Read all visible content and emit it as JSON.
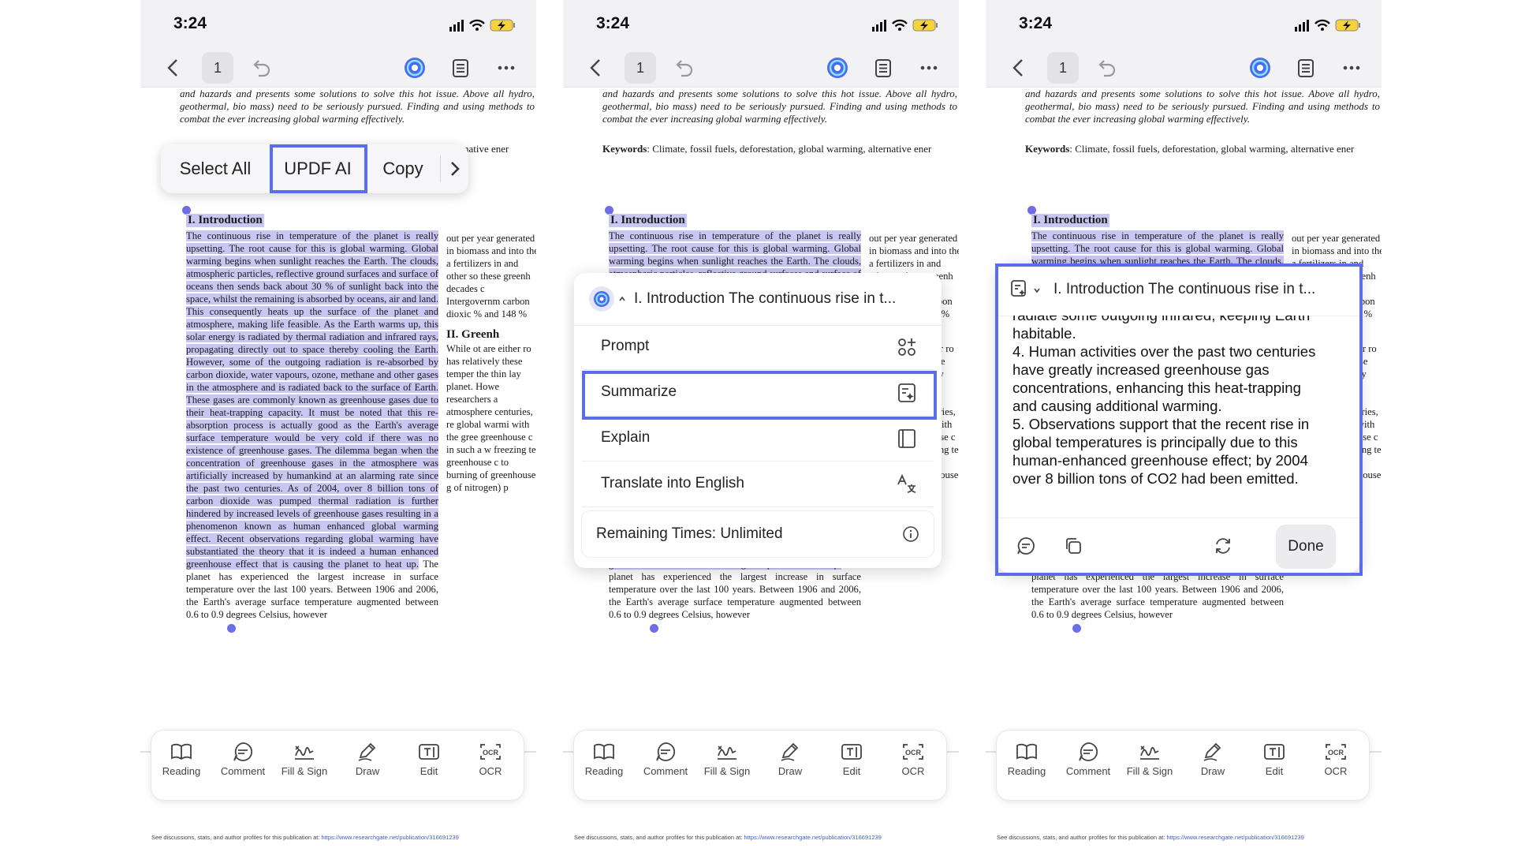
{
  "status": {
    "time": "3:24"
  },
  "toolbar": {
    "page": "1"
  },
  "doc": {
    "abstract": "and hazards and presents some solutions to solve this hot issue. Above all hydro, geothermal, bio mass) need to be seriously pursued. Finding and using methods to combat the ever increasing global warming effectively.",
    "keywords_label": "Keywords",
    "keywords_text": ": Climate, fossil fuels, deforestation, global warming, alternative ener",
    "intro_heading": "I. Introduction",
    "intro_body": "The continuous rise in temperature of the planet is really upsetting. The root cause for this is global warming. Global warming begins when sunlight reaches the Earth. The clouds, atmospheric particles, reflective ground surfaces and surface of oceans then sends back about 30 % of sunlight back into the space, whilst the remaining is absorbed by oceans, air and land. This consequently heats up the surface of the planet and atmosphere, making life feasible. As the Earth warms up, this solar energy is radiated by thermal radiation and infrared rays, propagating directly out to space thereby cooling the Earth. However, some of the outgoing radiation is re-absorbed by carbon dioxide, water vapours, ozone, methane and other gases in the atmosphere and is radiated back to the surface of Earth. These gases are commonly known as greenhouse gases due to their heat-trapping capacity. It must be noted that this re-absorption process is actually good as the Earth's average surface temperature would be very cold if there was no existence of greenhouse gases. The dilemma began when the concentration of greenhouse gases in the atmosphere was artificially increased by humankind at an alarming rate since the past two centuries. As of 2004, over 8 billion tons of carbon dioxide was pumped thermal radiation is further hindered by increased levels of greenhouse gases resulting in a phenomenon known as human enhanced global warming effect. Recent observations regarding global warming have substantiated the theory that it is indeed a human enhanced greenhouse effect that is causing the planet to heat up.",
    "intro_tail": " The planet has experienced the largest increase in surface temperature over the last 100 years. Between 1906 and 2006, the Earth's average surface temperature augmented between 0.6 to 0.9 degrees Celsius, however",
    "col2_top": "out per year generated in biomass and into the a fertilizers in and other so these greenh decades c Intergovernm carbon dioxic % and 148 %",
    "col2_heading": "II. Greenh",
    "col2_bottom": "While ot are either ro has relatively these temper the thin lay planet. Howe researchers a atmosphere centuries, re global warmi with the gree greenhouse c in such a w freezing te greenhouse c to burning of greenhouse g of nitrogen) p"
  },
  "context_menu": {
    "items": [
      "Select All",
      "UPDF AI",
      "Copy"
    ]
  },
  "ai_menu": {
    "header": "I. Introduction The continuous rise in t...",
    "items": [
      "Prompt",
      "Summarize",
      "Explain",
      "Translate into English"
    ],
    "remaining": "Remaining Times: Unlimited"
  },
  "ai_response": {
    "header": "I. Introduction The continuous rise in t...",
    "cut_line": "radiate some outgoing infrared, keeping Earth",
    "lines": [
      "habitable.",
      "4. Human activities over the past two centuries",
      "have greatly increased greenhouse gas",
      "concentrations, enhancing this heat-trapping",
      "and causing additional warming.",
      "5. Observations support that the recent rise in",
      "global temperatures is principally due to this",
      "human-enhanced greenhouse effect; by 2004",
      "over 8 billion tons of CO2 had been emitted."
    ],
    "done": "Done"
  },
  "bottom_bar": {
    "items": [
      "Reading",
      "Comment",
      "Fill & Sign",
      "Draw",
      "Edit",
      "OCR"
    ]
  },
  "footer": {
    "text": "See discussions, stats, and author profiles for this publication at: ",
    "link": "https://www.researchgate.net/publication/316691239"
  },
  "colors": {
    "accent": "#5b6ee8",
    "highlight": "#c9c6f4",
    "toolbar": "#f2f2f4"
  },
  "icons": [
    "back-chevron-icon",
    "undo-icon",
    "updf-ai-icon",
    "outline-icon",
    "more-icon",
    "book-icon",
    "comment-icon",
    "signature-icon",
    "pen-icon",
    "edit-icon",
    "ocr-icon"
  ]
}
